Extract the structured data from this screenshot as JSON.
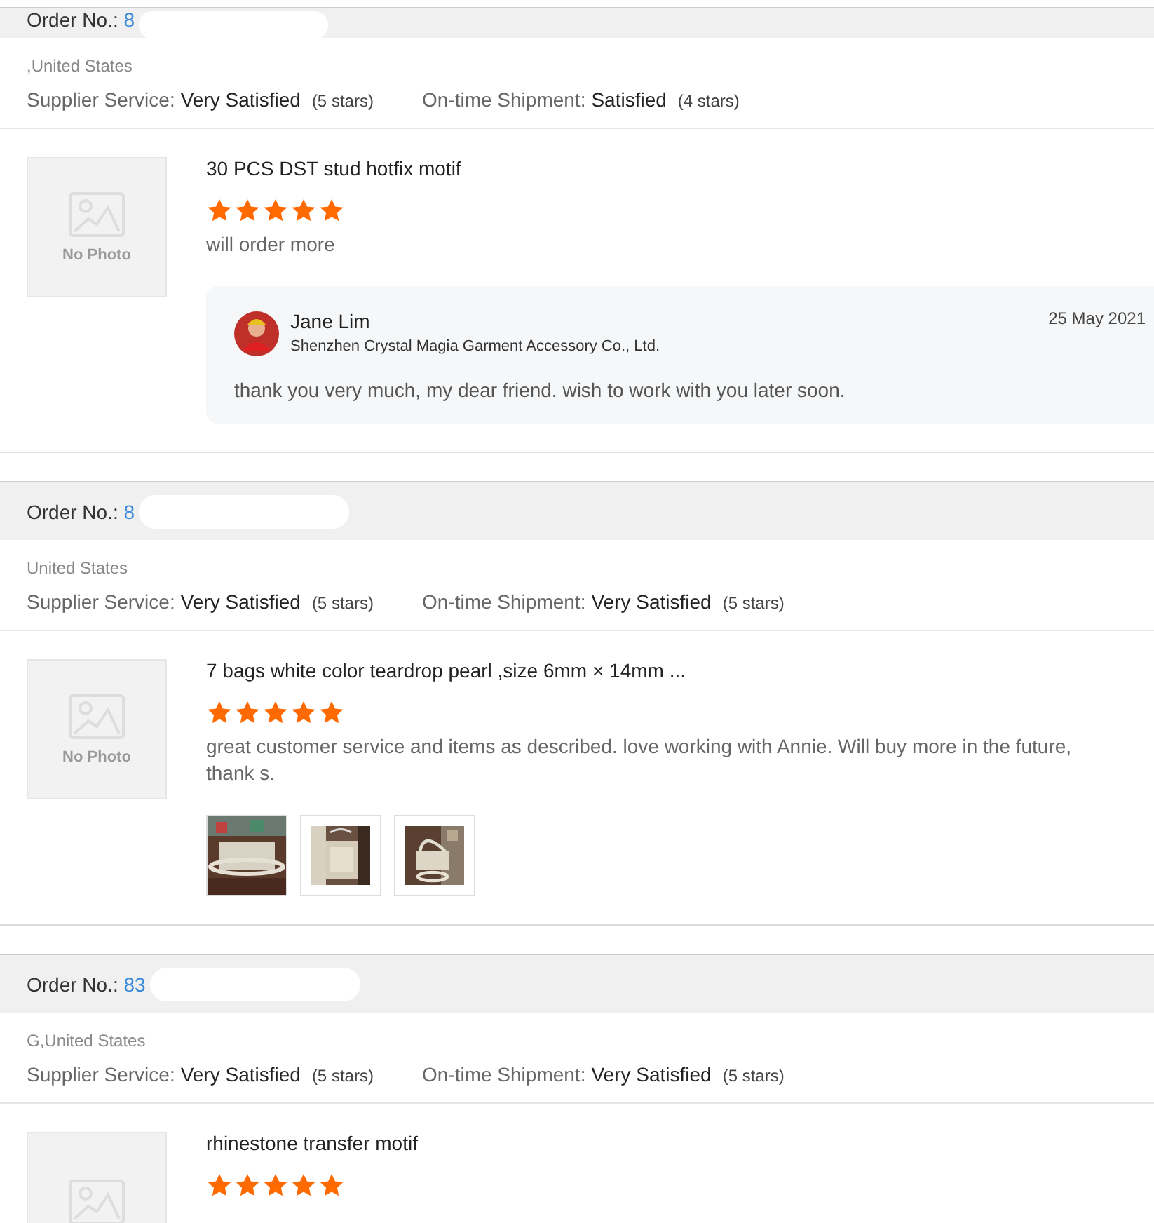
{
  "orders": [
    {
      "order_label": "Order No.:",
      "order_number": "8",
      "country": ",United States",
      "ratings": [
        {
          "label": "Supplier Service:",
          "value": "Very Satisfied",
          "count": "(5 stars)"
        },
        {
          "label": "On-time Shipment:",
          "value": "Satisfied",
          "count": "(4 stars)"
        }
      ],
      "product": {
        "photo": "No Photo",
        "title": "30 PCS DST stud hotfix motif",
        "stars": 5,
        "comment": "will order more",
        "reply": {
          "name": "Jane Lim",
          "company": "Shenzhen Crystal Magia Garment Accessory Co., Ltd.",
          "date": "25 May 2021",
          "text": "thank you very much, my dear friend. wish to work with you later soon."
        }
      }
    },
    {
      "order_label": "Order No.:",
      "order_number": "8",
      "country": "United States",
      "ratings": [
        {
          "label": "Supplier Service:",
          "value": "Very Satisfied",
          "count": "(5 stars)"
        },
        {
          "label": "On-time Shipment:",
          "value": "Very Satisfied",
          "count": "(5 stars)"
        }
      ],
      "product": {
        "photo": "No Photo",
        "title": "7 bags white color teardrop pearl ,size 6mm × 14mm ...",
        "stars": 5,
        "comment": "great customer service and items as described. love working with Annie. Will buy more in the future, thank s.",
        "attachments": [
          {
            "kind": "picture"
          },
          {
            "kind": "picture"
          },
          {
            "kind": "picture"
          }
        ]
      }
    },
    {
      "order_label": "Order No.:",
      "order_number": "83",
      "country": "G,United States",
      "ratings": [
        {
          "label": "Supplier Service:",
          "value": "Very Satisfied",
          "count": "(5 stars)"
        },
        {
          "label": "On-time Shipment:",
          "value": "Very Satisfied",
          "count": "(5 stars)"
        }
      ],
      "product": {
        "title": "rhinestone transfer motif",
        "stars": 5
      }
    }
  ]
}
